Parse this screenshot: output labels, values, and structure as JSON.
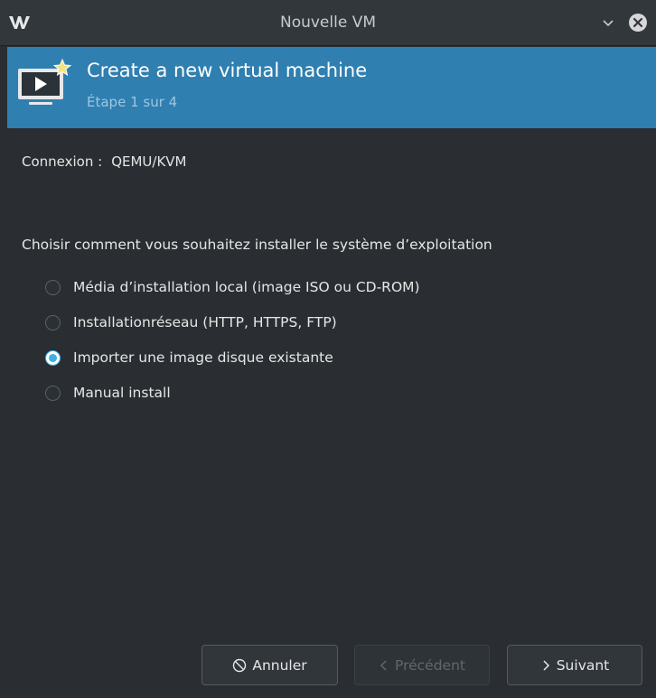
{
  "window": {
    "title": "Nouvelle VM",
    "logo": "vm-logo",
    "controls": [
      "chevron-down-icon",
      "close-icon"
    ]
  },
  "banner": {
    "title": "Create a new virtual machine",
    "step": "Étape 1 sur 4",
    "icon": "new-vm-icon",
    "background": "#2f7fb0"
  },
  "connection": {
    "label": "Connexion :",
    "value": "QEMU/KVM"
  },
  "install": {
    "question": "Choisir comment vous souhaitez installer le système d’exploitation",
    "selected_index": 2,
    "options": [
      {
        "label": "Média d’installation local (image ISO ou CD-ROM)",
        "checked": false
      },
      {
        "label": "Installationréseau (HTTP, HTTPS, FTP)",
        "checked": false
      },
      {
        "label": "Importer une image disque existante",
        "checked": true
      },
      {
        "label": "Manual install",
        "checked": false
      }
    ]
  },
  "footer": {
    "cancel_label": "Annuler",
    "back_label": "Précédent",
    "back_disabled": true,
    "next_label": "Suivant"
  },
  "colors": {
    "accent": "#3daee9",
    "background": "#2a2e32"
  }
}
